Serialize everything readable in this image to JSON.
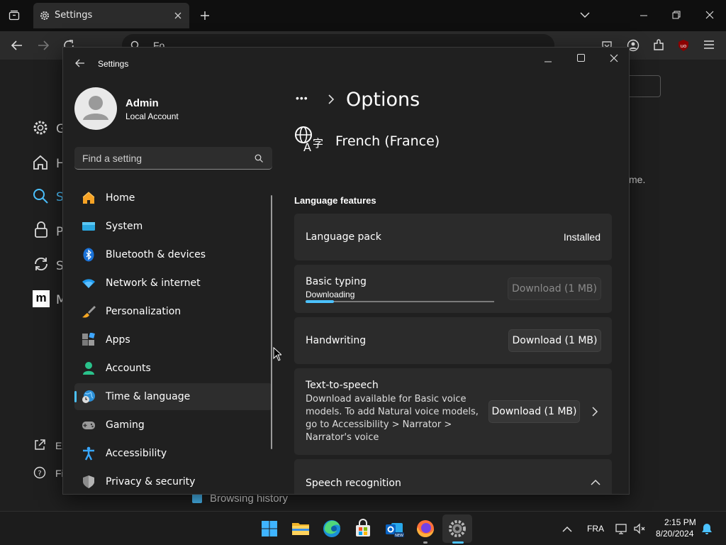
{
  "browser": {
    "tab_title": "Settings",
    "url_text": "Fo",
    "background_nav": [
      "G",
      "H",
      "S",
      "P",
      "S",
      "M"
    ],
    "background_footer": [
      "Ex",
      "Fi"
    ],
    "background_text": "me.",
    "background_checkbox_label": "Browsing history"
  },
  "settings": {
    "window_title": "Settings",
    "user": {
      "name": "Admin",
      "account": "Local Account"
    },
    "search_placeholder": "Find a setting",
    "nav": [
      {
        "label": "Home",
        "icon": "home-icon"
      },
      {
        "label": "System",
        "icon": "system-icon"
      },
      {
        "label": "Bluetooth & devices",
        "icon": "bluetooth-icon"
      },
      {
        "label": "Network & internet",
        "icon": "wifi-icon"
      },
      {
        "label": "Personalization",
        "icon": "brush-icon"
      },
      {
        "label": "Apps",
        "icon": "apps-icon"
      },
      {
        "label": "Accounts",
        "icon": "accounts-icon"
      },
      {
        "label": "Time & language",
        "icon": "globe-clock-icon",
        "active": true
      },
      {
        "label": "Gaming",
        "icon": "gamepad-icon"
      },
      {
        "label": "Accessibility",
        "icon": "accessibility-icon"
      },
      {
        "label": "Privacy & security",
        "icon": "shield-icon"
      }
    ],
    "breadcrumb": {
      "ellipsis": "•••",
      "current": "Options"
    },
    "language_name": "French (France)",
    "section_title": "Language features",
    "features": {
      "language_pack": {
        "title": "Language pack",
        "status": "Installed"
      },
      "basic_typing": {
        "title": "Basic typing",
        "status": "Downloading",
        "progress_percent": 15,
        "button": "Download (1 MB)"
      },
      "handwriting": {
        "title": "Handwriting",
        "button": "Download (1 MB)"
      },
      "text_to_speech": {
        "title": "Text-to-speech",
        "desc_lines": [
          "Download available for Basic voice",
          "models. To add Natural voice models,",
          "go to Accessibility > Narrator >",
          "Narrator's voice"
        ],
        "button": "Download (1 MB)"
      },
      "speech_recognition": {
        "title": "Speech recognition"
      }
    }
  },
  "taskbar": {
    "language": "FRA",
    "time": "2:15 PM",
    "date": "8/20/2024"
  },
  "colors": {
    "accent": "#4cc2ff",
    "window_bg": "#202020",
    "card_bg": "#2b2b2b"
  }
}
